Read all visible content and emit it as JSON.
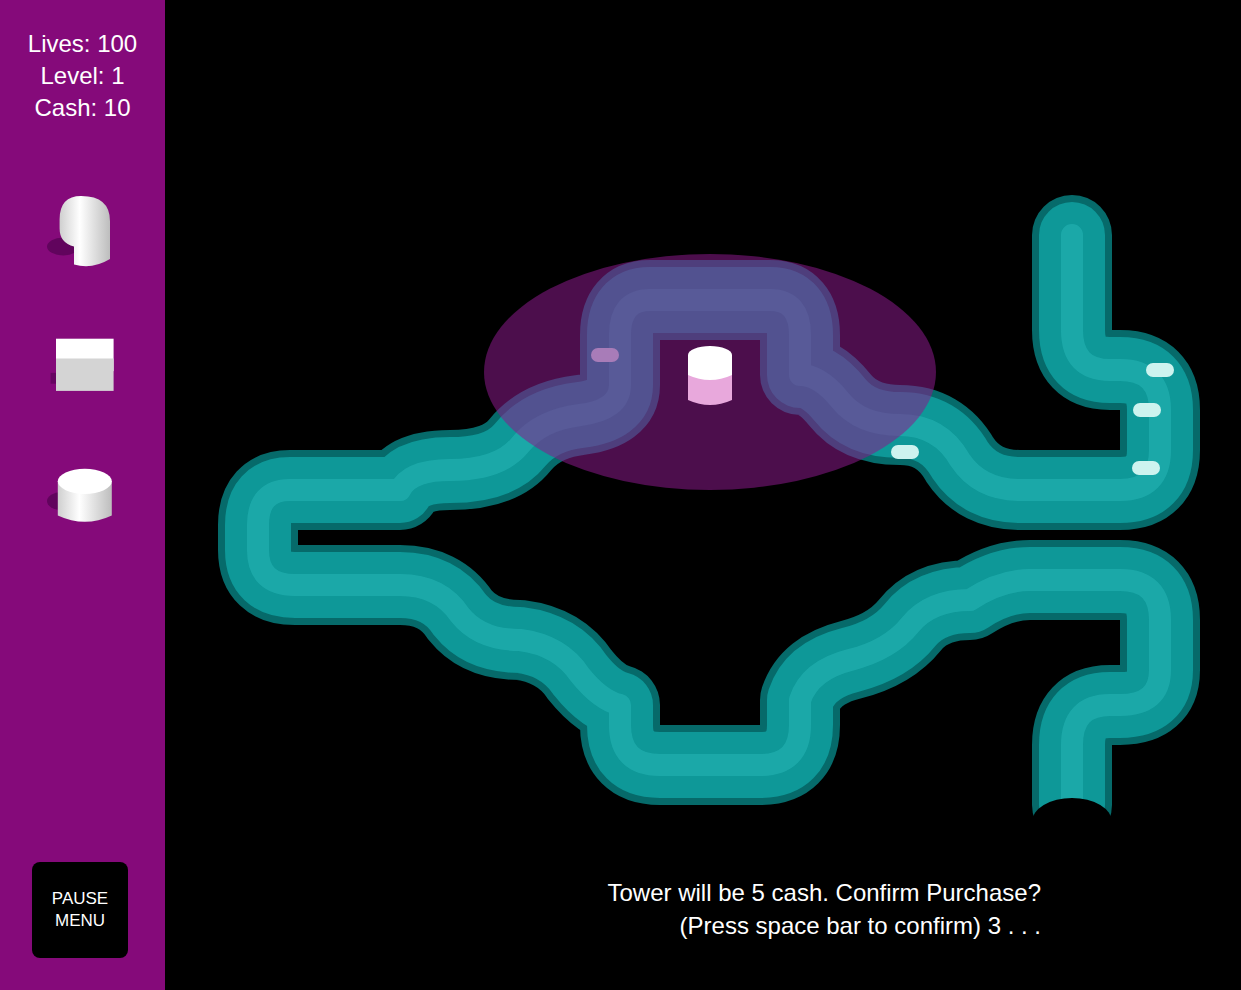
{
  "sidebar": {
    "stats": [
      "Lives: 100",
      "Level: 1",
      "Cash: 10"
    ],
    "towers": [
      {
        "kind": "dome"
      },
      {
        "kind": "box"
      },
      {
        "kind": "cylinder"
      }
    ],
    "pause_button": [
      "PAUSE",
      "MENU"
    ]
  },
  "prompt": [
    "Tower will be 5 cash. Confirm Purchase?",
    "(Press space bar to confirm) 3 . . ."
  ]
}
